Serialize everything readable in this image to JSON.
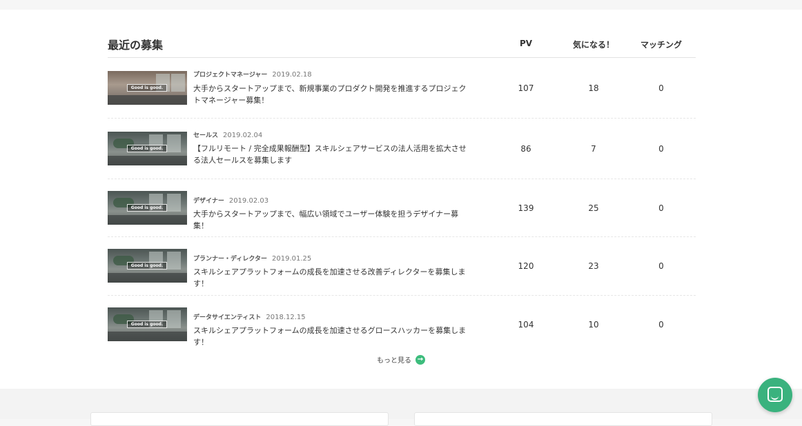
{
  "section": {
    "title": "最近の募集",
    "columns": {
      "pv": "PV",
      "interest": "気になる！",
      "matching": "マッチング"
    }
  },
  "jobs": [
    {
      "category": "プロジェクトマネージャー",
      "date": "2019.02.18",
      "title": "大手からスタートアップまで、新規事業のプロダクト開発を推進するプロジェクトマネージャー募集！",
      "pv": "107",
      "interest": "18",
      "matching": "0",
      "thumb_badge": "Good is good."
    },
    {
      "category": "セールス",
      "date": "2019.02.04",
      "title": "【フルリモート / 完全成果報酬型】スキルシェアサービスの法人活用を拡大させる法人セールスを募集します",
      "pv": "86",
      "interest": "7",
      "matching": "0",
      "thumb_badge": "Good is good."
    },
    {
      "category": "デザイナー",
      "date": "2019.02.03",
      "title": "大手からスタートアップまで、幅広い領域でユーザー体験を担うデザイナー募集！",
      "pv": "139",
      "interest": "25",
      "matching": "0",
      "thumb_badge": "Good is good."
    },
    {
      "category": "プランナー・ディレクター",
      "date": "2019.01.25",
      "title": "スキルシェアプラットフォームの成長を加速させる改善ディレクターを募集します！",
      "pv": "120",
      "interest": "23",
      "matching": "0",
      "thumb_badge": "Good is good."
    },
    {
      "category": "データサイエンティスト",
      "date": "2018.12.15",
      "title": "スキルシェアプラットフォームの成長を加速させるグロースハッカーを募集します！",
      "pv": "104",
      "interest": "10",
      "matching": "0",
      "thumb_badge": "Good is good."
    }
  ],
  "more": {
    "label": "もっと見る",
    "icon": "arrow-right-circle-icon"
  },
  "chat": {
    "icon": "chat-icon"
  },
  "colors": {
    "accent": "#3dbd7d",
    "chat": "#3ab27e"
  }
}
